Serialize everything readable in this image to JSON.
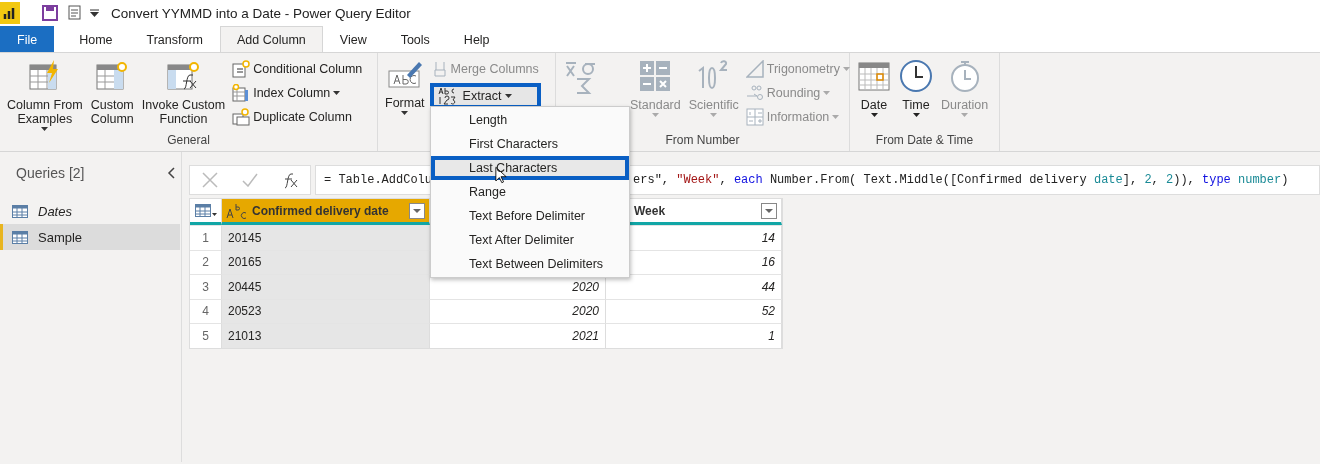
{
  "window": {
    "title": "Convert YYMMD into a Date - Power Query Editor"
  },
  "tabs": [
    {
      "label": "File",
      "selected": false,
      "kind": "file"
    },
    {
      "label": "Home",
      "selected": false,
      "kind": "tab"
    },
    {
      "label": "Transform",
      "selected": false,
      "kind": "tab"
    },
    {
      "label": "Add Column",
      "selected": true,
      "kind": "tab"
    },
    {
      "label": "View",
      "selected": false,
      "kind": "tab"
    },
    {
      "label": "Tools",
      "selected": false,
      "kind": "tab"
    },
    {
      "label": "Help",
      "selected": false,
      "kind": "tab"
    }
  ],
  "ribbon": {
    "general": {
      "label": "General",
      "large": [
        {
          "label": "Column From\nExamples",
          "caret": true
        },
        {
          "label": "Custom\nColumn",
          "caret": false
        },
        {
          "label": "Invoke Custom\nFunction",
          "caret": false
        }
      ],
      "small": [
        {
          "label": "Conditional Column",
          "caret": false
        },
        {
          "label": "Index Column",
          "caret": true
        },
        {
          "label": "Duplicate Column",
          "caret": false
        }
      ]
    },
    "from_text": {
      "format": {
        "label": "Format",
        "caret": true
      },
      "merge": {
        "label": "Merge Columns",
        "disabled": true
      },
      "extract": {
        "label": "Extract",
        "highlighted": true,
        "open": true
      }
    },
    "from_number": {
      "label": "From Number",
      "large": [
        {
          "disabled": true
        },
        {
          "label": "Standard",
          "disabled": true
        },
        {
          "label": "Scientific",
          "disabled": true
        }
      ],
      "small": [
        {
          "label": "Trigonometry",
          "disabled": true
        },
        {
          "label": "Rounding",
          "disabled": true
        },
        {
          "label": "Information",
          "disabled": true
        }
      ]
    },
    "from_date_time": {
      "label": "From Date & Time",
      "buttons": [
        {
          "label": "Date",
          "disabled": false
        },
        {
          "label": "Time",
          "disabled": false
        },
        {
          "label": "Duration",
          "disabled": true
        }
      ]
    }
  },
  "extract_menu": [
    {
      "label": "Length",
      "highlighted": false
    },
    {
      "label": "First Characters",
      "highlighted": false
    },
    {
      "label": "Last Characters",
      "highlighted": true
    },
    {
      "label": "Range",
      "highlighted": false
    },
    {
      "label": "Text Before Delimiter",
      "highlighted": false
    },
    {
      "label": "Text After Delimiter",
      "highlighted": false
    },
    {
      "label": "Text Between Delimiters",
      "highlighted": false
    }
  ],
  "queries": {
    "title": "Queries [2]",
    "items": [
      {
        "name": "Dates",
        "loaded": false,
        "selected": false
      },
      {
        "name": "Sample",
        "loaded": true,
        "selected": true
      }
    ]
  },
  "formula_bar": {
    "left": "= Table.AddColu",
    "right": [
      {
        "text": "ers\", ",
        "kind": "plain"
      },
      {
        "text": "\"Week\"",
        "kind": "string"
      },
      {
        "text": ", ",
        "kind": "plain"
      },
      {
        "text": "each",
        "kind": "keyword"
      },
      {
        "text": " Number.From( Text.Middle([Confirmed delivery ",
        "kind": "plain"
      },
      {
        "text": "date",
        "kind": "type"
      },
      {
        "text": "], ",
        "kind": "plain"
      },
      {
        "text": "2",
        "kind": "type"
      },
      {
        "text": ", ",
        "kind": "plain"
      },
      {
        "text": "2",
        "kind": "type"
      },
      {
        "text": ")), ",
        "kind": "plain"
      },
      {
        "text": "type",
        "kind": "keyword"
      },
      {
        "text": " number",
        "kind": "type"
      },
      {
        "text": ")",
        "kind": "plain"
      }
    ]
  },
  "table": {
    "columns": [
      {
        "name": "Confirmed delivery date",
        "selected": true
      },
      {
        "selected": false
      },
      {
        "name": "Week",
        "selected": false
      }
    ],
    "rows": [
      {
        "index": "1",
        "cells": [
          "20145",
          null,
          "14"
        ]
      },
      {
        "index": "2",
        "cells": [
          "20165",
          null,
          "16"
        ]
      },
      {
        "index": "3",
        "cells": [
          "20445",
          "2020",
          "44"
        ]
      },
      {
        "index": "4",
        "cells": [
          "20523",
          "2020",
          "52"
        ]
      },
      {
        "index": "5",
        "cells": [
          "21013",
          "2021",
          "1"
        ]
      }
    ]
  }
}
